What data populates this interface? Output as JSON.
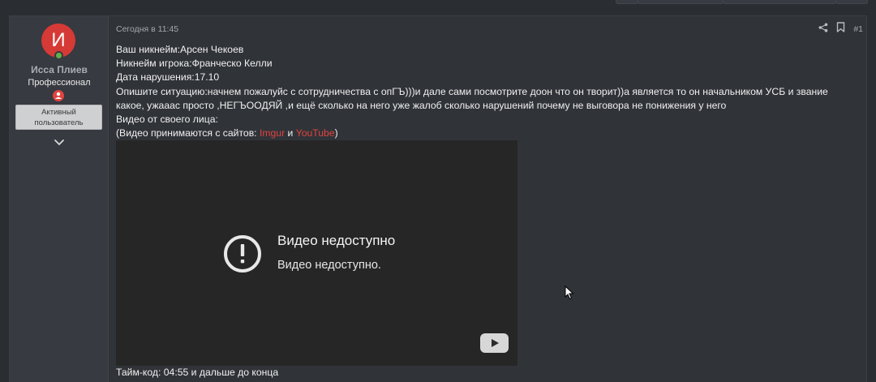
{
  "user": {
    "avatar_letter": "И",
    "name": "Исса Плиев",
    "title": "Професcионал",
    "banner_line1": "Активный",
    "banner_line2": "пользователь",
    "avatar_color": "#d63a36",
    "online_color": "#5fb049"
  },
  "post": {
    "date": "Сегодня в 11:45",
    "number": "#1",
    "lines": [
      "Ваш никнейм:Арсен Чекоев",
      "Никнейм игрока:Франческо Келли",
      "Дата нарушения:17.10",
      "Опишите ситуацию:начнем пожалуйс с сотрудничества с опГЪ)))и дале сами посмотрите доон что он творит))а является то он начальником УСБ и звание какое, ужааас просто ,НЕГЪООДЯЙ ,и ещё сколько на него уже жалоб сколько нарушений почему не выговора не понижения у него",
      "Видео от своего лица:"
    ],
    "video_note_prefix": "(Видео принимаются с сайтов: ",
    "link_imgur": "Imgur",
    "video_note_and": " и ",
    "link_youtube": "YouTube",
    "video_note_suffix": ")",
    "timecode": "Тайм-код: 04:55 и дальше до конца",
    "link_color": "#e0443f"
  },
  "video": {
    "title": "Видео недоступно",
    "subtitle": "Видео недоступно.",
    "icons": [
      "warning-icon",
      "youtube-logo-icon"
    ]
  },
  "icons": [
    "share-icon",
    "bookmark-icon",
    "chevron-down-icon",
    "user-badge-icon",
    "mouse-cursor-icon"
  ]
}
